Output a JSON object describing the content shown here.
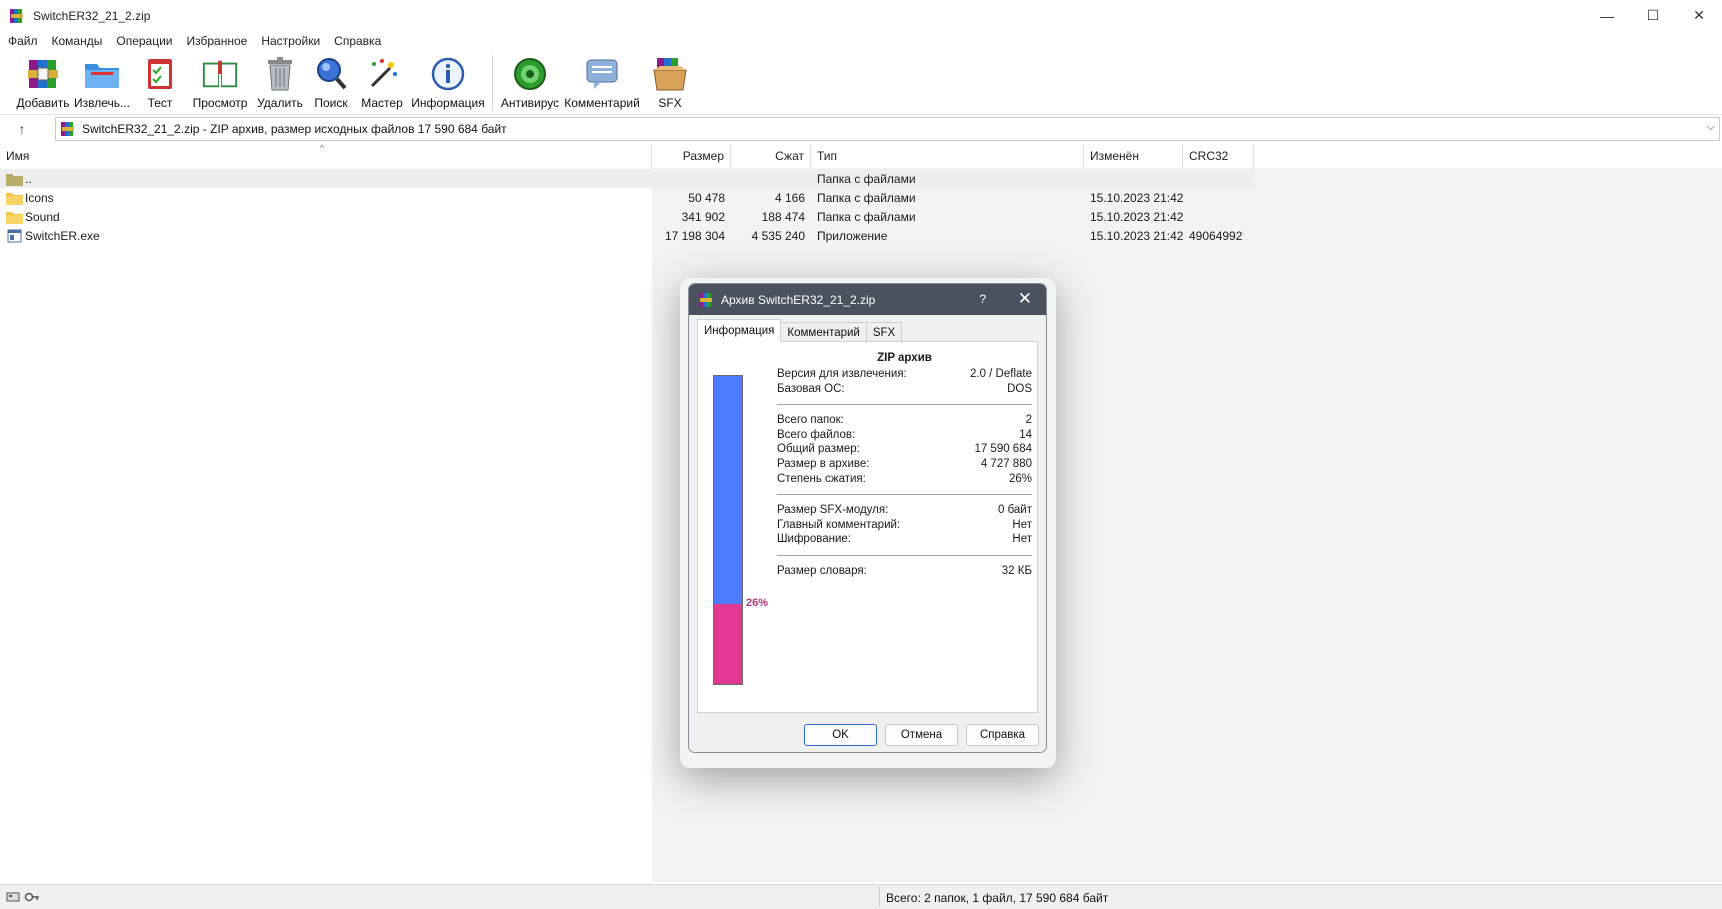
{
  "window": {
    "title": "SwitchER32_21_2.zip",
    "controls": {
      "minimize": "—",
      "maximize": "☐",
      "close": "✕"
    }
  },
  "menu": [
    "Файл",
    "Команды",
    "Операции",
    "Избранное",
    "Настройки",
    "Справка"
  ],
  "toolbar": [
    {
      "label": "Добавить",
      "icon": "add-archive-icon"
    },
    {
      "label": "Извлечь...",
      "icon": "extract-folder-icon"
    },
    {
      "label": "Тест",
      "icon": "test-checklist-icon"
    },
    {
      "label": "Просмотр",
      "icon": "view-book-icon"
    },
    {
      "label": "Удалить",
      "icon": "trash-can-icon"
    },
    {
      "label": "Поиск",
      "icon": "magnifier-icon"
    },
    {
      "label": "Мастер",
      "icon": "magic-wand-icon"
    },
    {
      "label": "Информация",
      "icon": "info-icon"
    },
    {
      "label": "Антивирус",
      "icon": "antivirus-icon"
    },
    {
      "label": "Комментарий",
      "icon": "comment-icon"
    },
    {
      "label": "SFX",
      "icon": "sfx-box-icon"
    }
  ],
  "address": {
    "text": "SwitchER32_21_2.zip - ZIP архив, размер исходных файлов 17 590 684 байт"
  },
  "columns": {
    "name": "Имя",
    "size": "Размер",
    "packed": "Сжат",
    "type": "Тип",
    "modified": "Изменён",
    "crc": "CRC32"
  },
  "files": [
    {
      "name": "..",
      "size": "",
      "packed": "",
      "type": "Папка с файлами",
      "modified": "",
      "crc": "",
      "kind": "parent"
    },
    {
      "name": "Icons",
      "size": "50 478",
      "packed": "4 166",
      "type": "Папка с файлами",
      "modified": "15.10.2023 21:42",
      "crc": "",
      "kind": "folder"
    },
    {
      "name": "Sound",
      "size": "341 902",
      "packed": "188 474",
      "type": "Папка с файлами",
      "modified": "15.10.2023 21:42",
      "crc": "",
      "kind": "folder"
    },
    {
      "name": "SwitchER.exe",
      "size": "17 198 304",
      "packed": "4 535 240",
      "type": "Приложение",
      "modified": "15.10.2023 21:42",
      "crc": "49064992",
      "kind": "exe"
    }
  ],
  "status": {
    "text": "Всего: 2 папок, 1 файл, 17 590 684 байт"
  },
  "dialog": {
    "title": "Архив SwitchER32_21_2.zip",
    "help": "?",
    "close": "✕",
    "tabs": [
      "Информация",
      "Комментарий",
      "SFX"
    ],
    "header": "ZIP архив",
    "compression_ratio": 0.26,
    "compression_label": "26%",
    "colors": {
      "original": "#4f7bff",
      "compressed": "#e03a93"
    },
    "groups": [
      [
        {
          "k": "Версия для извлечения:",
          "v": "2.0 / Deflate"
        },
        {
          "k": "Базовая ОС:",
          "v": "DOS"
        }
      ],
      [
        {
          "k": "Всего папок:",
          "v": "2"
        },
        {
          "k": "Всего файлов:",
          "v": "14"
        },
        {
          "k": "Общий размер:",
          "v": "17 590 684"
        },
        {
          "k": "Размер в архиве:",
          "v": "4 727 880"
        },
        {
          "k": "Степень сжатия:",
          "v": "26%"
        }
      ],
      [
        {
          "k": "Размер SFX-модуля:",
          "v": "0 байт"
        },
        {
          "k": "Главный комментарий:",
          "v": "Нет"
        },
        {
          "k": "Шифрование:",
          "v": "Нет"
        }
      ],
      [
        {
          "k": "Размер словаря:",
          "v": "32 КБ"
        }
      ]
    ],
    "buttons": {
      "ok": "OK",
      "cancel": "Отмена",
      "help": "Справка"
    }
  }
}
